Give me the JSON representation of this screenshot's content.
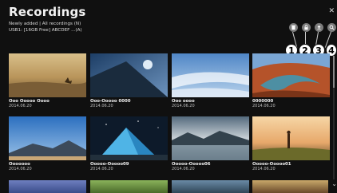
{
  "header": {
    "title": "Recordings",
    "filter_line": "Newly added | All recordings (N)",
    "storage_line": "USB1: [16GB Free] ABCDEF ...(A)",
    "close_icon": "close-icon"
  },
  "toolbar": {
    "buttons": [
      {
        "icon": "delete-icon"
      },
      {
        "icon": "lock-icon"
      },
      {
        "icon": "upload-icon"
      },
      {
        "icon": "search-icon"
      }
    ],
    "callouts": [
      "1",
      "2",
      "3",
      "4"
    ]
  },
  "recordings": [
    {
      "name": "Ooo Ooooo Oooo",
      "date": "2014.06.20"
    },
    {
      "name": "Ooo-Ooooo 0000",
      "date": "2014.06.20"
    },
    {
      "name": "Ooo oooo",
      "date": "2014.06.20"
    },
    {
      "name": "0000000",
      "date": "2014.06.20"
    },
    {
      "name": "Ooooooo",
      "date": "2014.06.20"
    },
    {
      "name": "Ooooo-Ooooo09",
      "date": "2014.06.20"
    },
    {
      "name": "Ooooo-Ooooo06",
      "date": "2014.06.20"
    },
    {
      "name": "Ooooo-Ooooo01",
      "date": "2014.06.20"
    }
  ]
}
